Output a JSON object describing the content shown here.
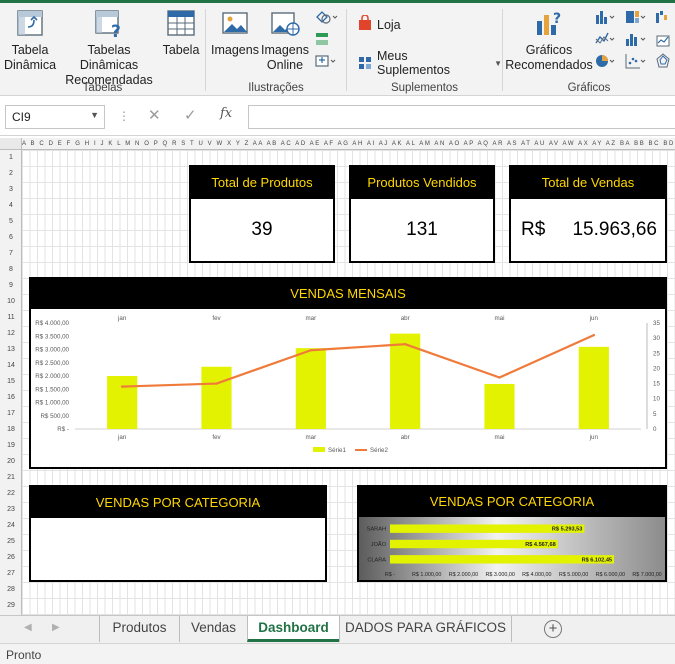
{
  "ribbon": {
    "tabelas_group": "Tabelas",
    "ilustracoes_group": "Ilustrações",
    "suplementos_group": "Suplementos",
    "graficos_group": "Gráficos",
    "tabela_dinamica_1": "Tabela",
    "tabela_dinamica_2": "Dinâmica",
    "tabelas_rec_1": "Tabelas Dinâmicas",
    "tabelas_rec_2": "Recomendadas",
    "tabela": "Tabela",
    "imagens": "Imagens",
    "imagens_online_1": "Imagens",
    "imagens_online_2": "Online",
    "loja": "Loja",
    "meus_suplementos": "Meus Suplementos",
    "graficos_rec_1": "Gráficos",
    "graficos_rec_2": "Recomendados"
  },
  "formula_bar": {
    "cell_ref": "CI9",
    "fx": "fx",
    "value": ""
  },
  "columns": "A B C D E F G H I J K L M N O P Q R S T U V W X Y Z AA AB AC AD AE AF AG AH AI AJ AK AL AM AN AO AP AQ AR AS AT AU AV AW AX AY AZ BA BB BC BD BE BF BG BH BI BJ BK BL BM BN BO BP BQ BR BS BT BU BV BW BX BY BZ CA CB",
  "rows": [
    "1",
    "2",
    "3",
    "4",
    "5",
    "6",
    "7",
    "8",
    "9",
    "10",
    "11",
    "12",
    "13",
    "14",
    "15",
    "16",
    "17",
    "18",
    "19",
    "20",
    "21",
    "22",
    "23",
    "24",
    "25",
    "26",
    "27",
    "28",
    "29"
  ],
  "kpis": [
    {
      "title": "Total de Produtos",
      "value": "39"
    },
    {
      "title": "Produtos Vendidos",
      "value": "131"
    },
    {
      "title": "Total de Vendas",
      "currency": "R$",
      "value": "15.963,66"
    }
  ],
  "panels": {
    "vendas_mensais": "VENDAS MENSAIS",
    "cat_left": "VENDAS POR CATEGORIA",
    "cat_right": "VENDAS POR CATEGORIA"
  },
  "chart_data": [
    {
      "type": "bar+line",
      "title": "",
      "categories": [
        "jan",
        "fev",
        "mar",
        "abr",
        "mai",
        "jun"
      ],
      "series": [
        {
          "name": "Série1",
          "kind": "bar",
          "axis": "left",
          "color": "#e2f200",
          "values": [
            2000,
            2350,
            3050,
            3600,
            1700,
            3100
          ]
        },
        {
          "name": "Série2",
          "kind": "line",
          "axis": "right",
          "color": "#f07a3a",
          "values": [
            14,
            15,
            26,
            28,
            17,
            31
          ]
        }
      ],
      "y_ticks_left": [
        "R$ -",
        "R$ 500,00",
        "R$ 1.000,00",
        "R$ 1.500,00",
        "R$ 2.000,00",
        "R$ 2.500,00",
        "R$ 3.000,00",
        "R$ 3.500,00",
        "R$ 4.000,00"
      ],
      "ylim_left": [
        0,
        4000
      ],
      "y_ticks_right": [
        "0",
        "5",
        "10",
        "15",
        "20",
        "25",
        "30",
        "35"
      ],
      "ylim_right": [
        0,
        35
      ],
      "legend_position": "bottom",
      "grid": false
    },
    {
      "type": "bar",
      "orientation": "horizontal",
      "title": "",
      "categories": [
        "SARAH",
        "JOÃO",
        "CLARA"
      ],
      "values": [
        5293.53,
        4567.68,
        6102.45
      ],
      "data_labels": [
        "R$ 5.293,53",
        "R$ 4.567,68",
        "R$ 6.102,45"
      ],
      "x_ticks": [
        "R$ -",
        "R$ 1.000,00",
        "R$ 2.000,00",
        "R$ 3.000,00",
        "R$ 4.000,00",
        "R$ 5.000,00",
        "R$ 6.000,00",
        "R$ 7.000,00"
      ],
      "xlim": [
        0,
        7000
      ],
      "color": "#e2f200",
      "grid": false
    }
  ],
  "sheet_tabs": [
    "Produtos",
    "Vendas",
    "Dashboard",
    "DADOS PARA GRÁFICOS"
  ],
  "active_tab": "Dashboard",
  "status": "Pronto"
}
